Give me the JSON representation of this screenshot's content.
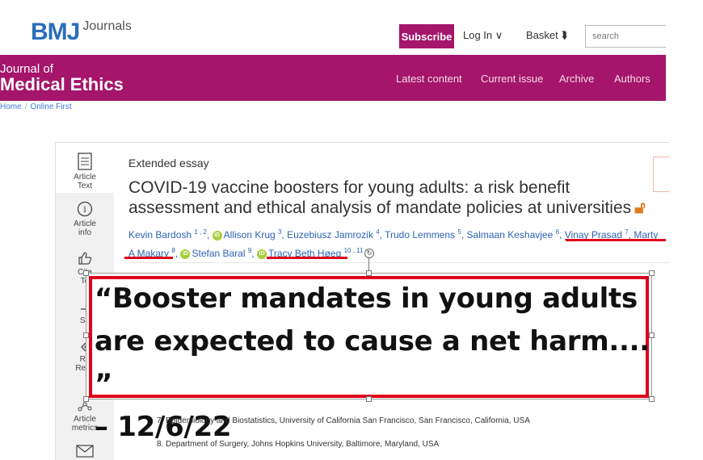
{
  "header": {
    "logo_bmj": "BMJ",
    "logo_journals": "Journals",
    "subscribe": "Subscribe",
    "login": "Log In ∨",
    "basket": "Basket ⮯",
    "search_placeholder": "search"
  },
  "journal": {
    "title_line1": "Journal of",
    "title_line2": "Medical Ethics",
    "nav": [
      "Latest content",
      "Current issue",
      "Archive",
      "Authors"
    ]
  },
  "breadcrumb": [
    "Home",
    "Online First"
  ],
  "sidebar": {
    "items": [
      {
        "label": "Article Text",
        "icon": "document-icon"
      },
      {
        "label": "Article info",
        "icon": "info-icon"
      },
      {
        "label": "Cita To",
        "icon": "thumbs-up-icon"
      },
      {
        "label": "Sh",
        "icon": "share-icon"
      },
      {
        "label": "Ra Resp",
        "icon": "rapid-response-icon"
      },
      {
        "label": "Article metrics",
        "icon": "metrics-icon"
      },
      {
        "label": "",
        "icon": "mail-icon"
      }
    ]
  },
  "article": {
    "type": "Extended essay",
    "title": "COVID-19 vaccine boosters for young adults: a risk benefit assessment and ethical analysis of mandate policies at universities",
    "open_access_icon": "open-access-lock-icon",
    "authors_line1": [
      {
        "name": "Kevin Bardosh",
        "sup": "1 , 2",
        "orcid": false
      },
      {
        "name": "Allison Krug",
        "sup": "3",
        "orcid": true
      },
      {
        "name": "Euzebiusz Jamrozik",
        "sup": "4",
        "orcid": false
      },
      {
        "name": "Trudo Lemmens",
        "sup": "5",
        "orcid": false
      },
      {
        "name": "Salmaan Keshavjee",
        "sup": "6",
        "orcid": false
      },
      {
        "name": "Vinay Prasad",
        "sup": "7",
        "orcid": false
      },
      {
        "name": "Marty",
        "sup": "",
        "orcid": false
      }
    ],
    "authors_line2": [
      {
        "name": "A Makary",
        "sup": "8",
        "orcid": false
      },
      {
        "name": "Stefan Baral",
        "sup": "9",
        "orcid": true
      },
      {
        "name": "Tracy Beth Høeg",
        "sup": "10 , 11",
        "orcid": true
      }
    ],
    "affiliations": [
      "7. Epidemiology and Biostatistics, University of California San Francisco, San Francisco, California, USA",
      "8. Department of Surgery, Johns Hopkins University, Baltimore, Maryland, USA"
    ]
  },
  "overlay_quote": {
    "line1": "“Booster mandates in young adults",
    "line2": "are expected to cause a net harm.... ”",
    "line3": "– 12/6/22"
  },
  "colors": {
    "brand_magenta": "#a5156b",
    "bmj_blue": "#2a6ebb",
    "link_blue": "#2c63b5",
    "highlight_red": "#e0001b",
    "orcid_green": "#a6ce39"
  }
}
